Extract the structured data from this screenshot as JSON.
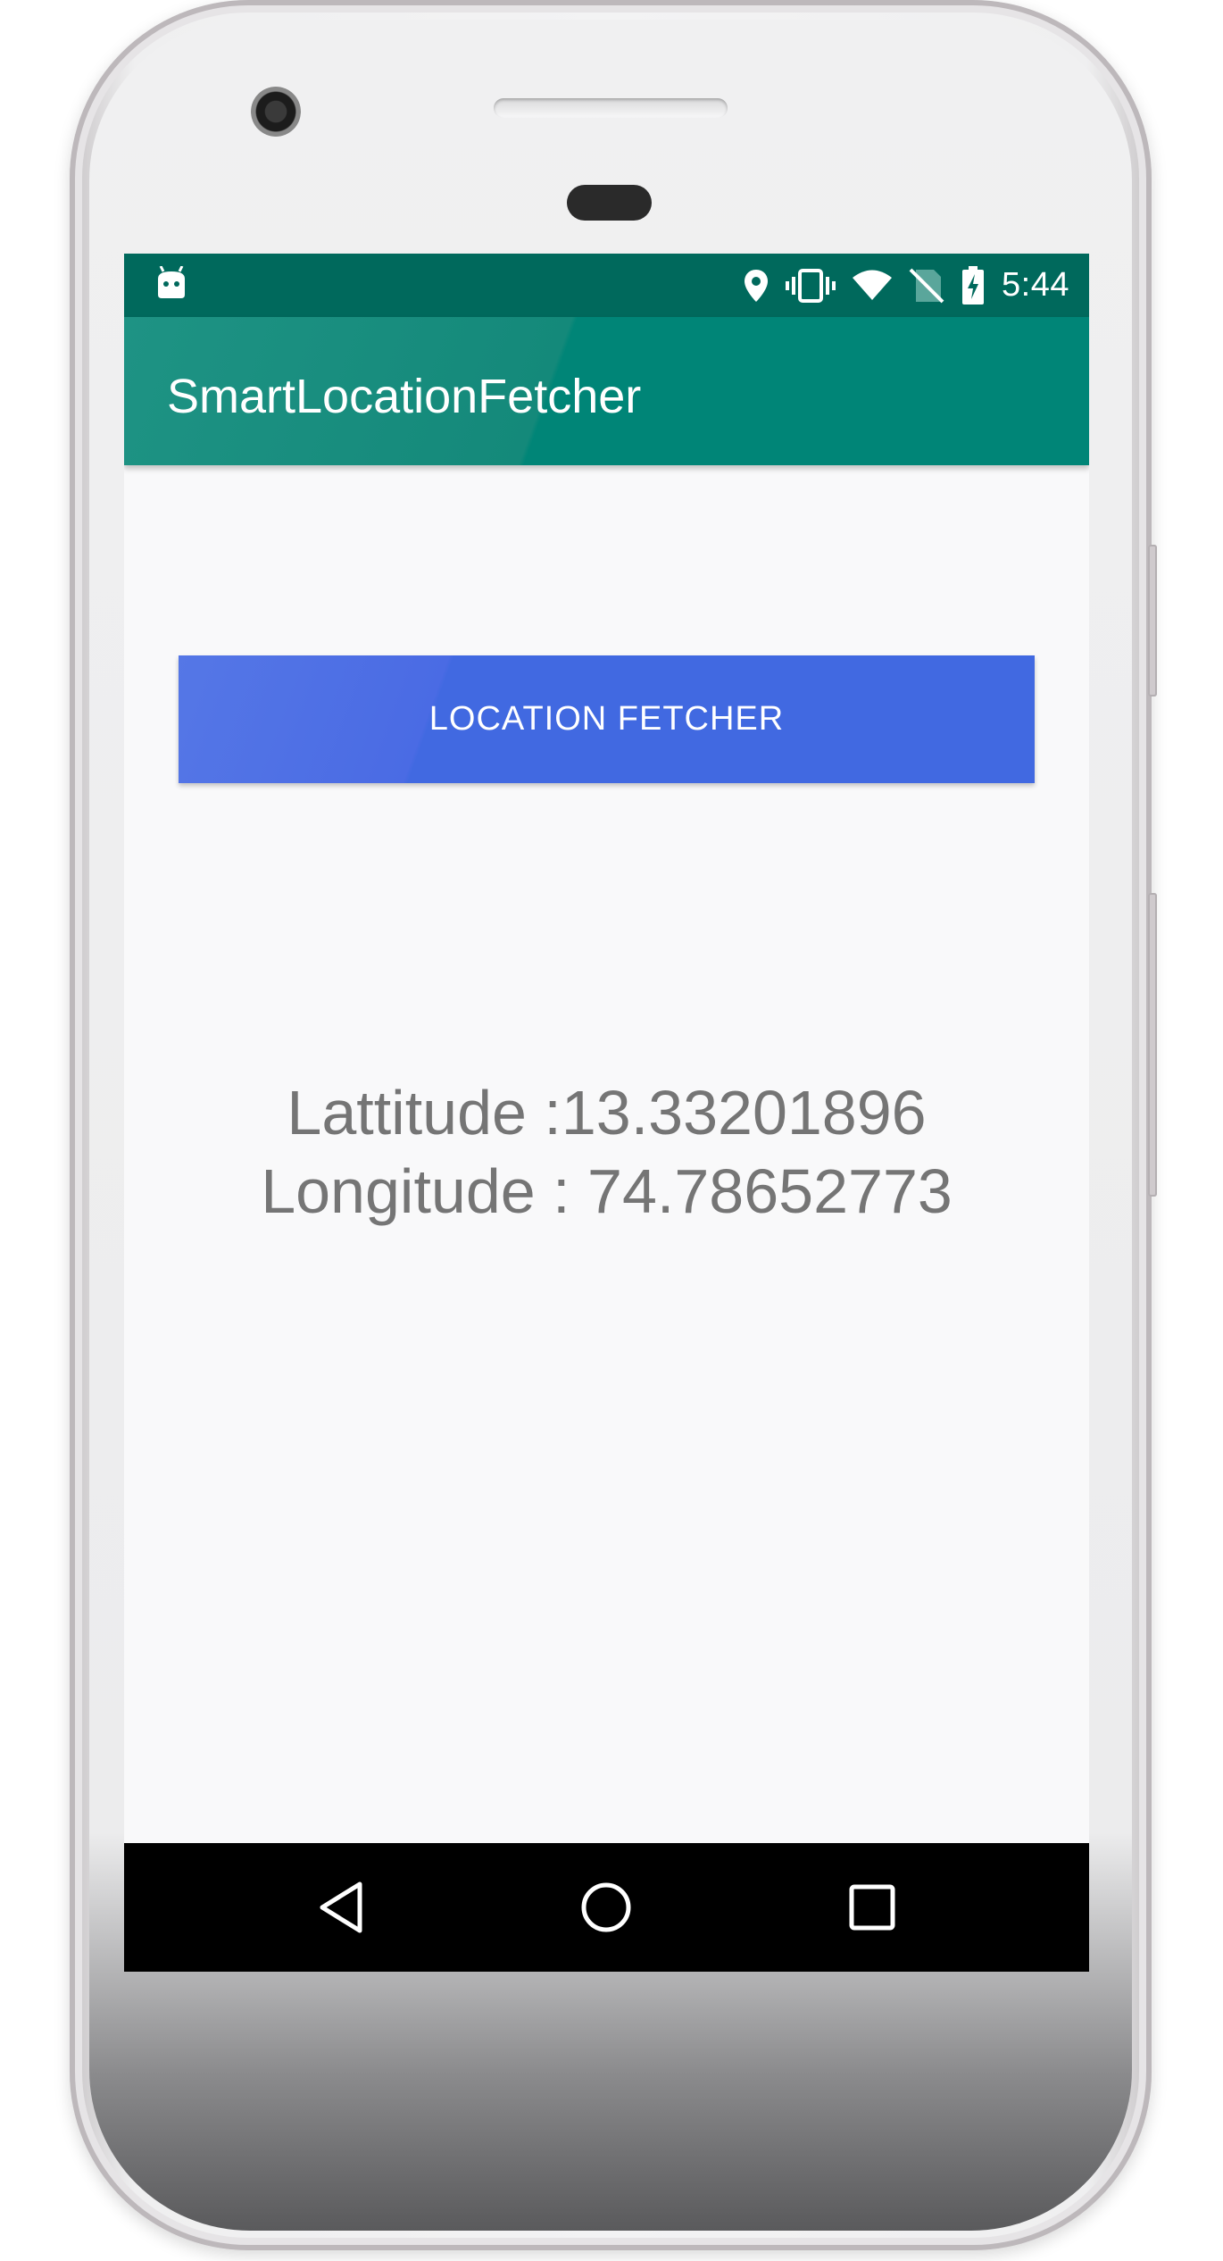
{
  "status_bar": {
    "time": "5:44",
    "icons": [
      "android-debug-icon",
      "location-pin-icon",
      "vibrate-icon",
      "wifi-icon",
      "no-sim-icon",
      "battery-charging-icon"
    ]
  },
  "app_bar": {
    "title": "SmartLocationFetcher"
  },
  "main": {
    "fetch_button_label": "LOCATION FETCHER",
    "latitude_text": "Lattitude :13.33201896",
    "longitude_text": "Longitude : 74.78652773"
  },
  "nav_bar": {
    "buttons": [
      "back-icon",
      "home-icon",
      "recents-icon"
    ]
  },
  "colors": {
    "status_bar": "#00695c",
    "app_bar": "#008577",
    "button": "#4169e1",
    "coords_text": "#757575"
  }
}
